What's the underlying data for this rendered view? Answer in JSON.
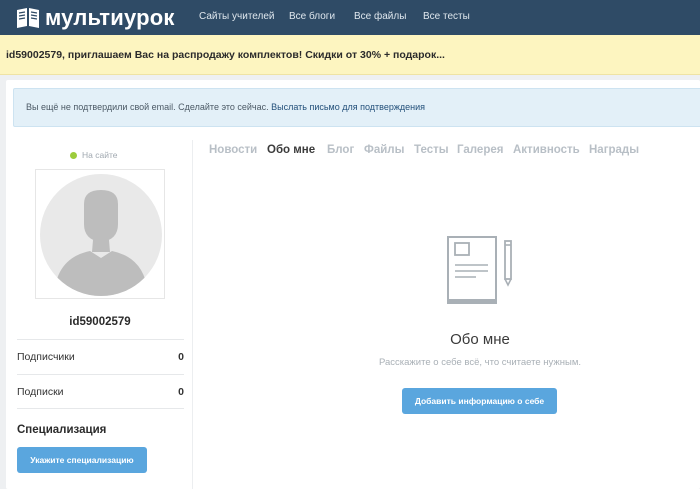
{
  "header": {
    "logo_text": "мультиурок",
    "nav": [
      "Сайты учителей",
      "Все блоги",
      "Все файлы",
      "Все тесты"
    ]
  },
  "promo": {
    "text": "id59002579, приглашаем Вас на распродажу комплектов! Скидки от 30% + подарок..."
  },
  "notice": {
    "text": "Вы ещё не подтвердили свой email. Сделайте это сейчас.",
    "link": "Выслать письмо для подтверждения"
  },
  "profile": {
    "status": "На сайте",
    "username": "id59002579",
    "stats": [
      {
        "label": "Подписчики",
        "value": "0"
      },
      {
        "label": "Подписки",
        "value": "0"
      }
    ],
    "specialization_title": "Специализация",
    "specialization_button": "Укажите специализацию"
  },
  "tabs": [
    "Новости",
    "Обо мне",
    "Блог",
    "Файлы",
    "Тесты",
    "Галерея",
    "Активность",
    "Награды"
  ],
  "active_tab": "Обо мне",
  "about": {
    "title": "Обо мне",
    "subtitle": "Расскажите о себе всё, что считаете нужным.",
    "button": "Добавить информацию о себе"
  },
  "colors": {
    "header_bg": "#2f4b66",
    "promo_bg": "#fdf5c0",
    "notice_bg": "#e3f0f8",
    "button": "#5aa6de",
    "online": "#9ccc3c"
  }
}
